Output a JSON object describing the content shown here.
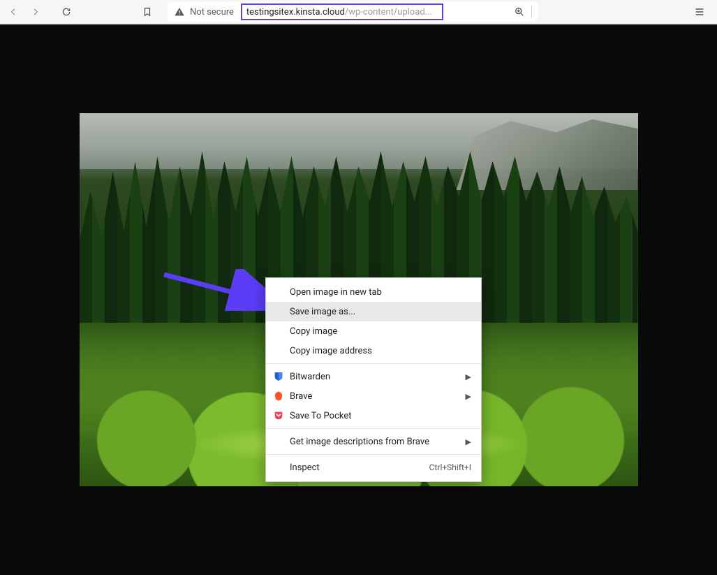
{
  "toolbar": {
    "not_secure_label": "Not secure",
    "url_host": "testingsitex.kinsta.cloud",
    "url_path": "/wp-content/upload"
  },
  "context_menu": {
    "open_new_tab": "Open image in new tab",
    "save_as": "Save image as...",
    "copy_image": "Copy image",
    "copy_address": "Copy image address",
    "bitwarden": "Bitwarden",
    "brave": "Brave",
    "save_pocket": "Save To Pocket",
    "get_descriptions": "Get image descriptions from Brave",
    "inspect": "Inspect",
    "inspect_shortcut": "Ctrl+Shift+I"
  },
  "annotation": {
    "url_highlight_color": "#5a3df5",
    "arrow_color": "#5a3df5"
  }
}
